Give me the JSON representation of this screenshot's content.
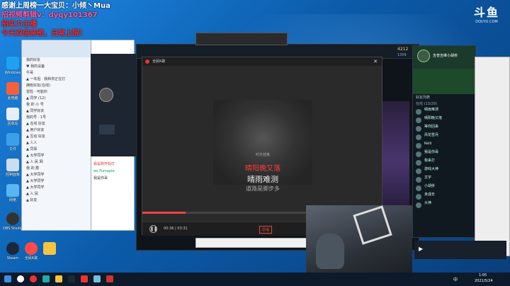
{
  "overlay": {
    "lines": [
      {
        "text": "感谢上周榜一大宝贝：小倾丶Mua",
        "color": "white"
      },
      {
        "text": "招视频剪辑v：dyqy101367",
        "color": "pink"
      },
      {
        "text": "招实力主播",
        "color": "red"
      },
      {
        "text": "今天双倍亲密，日常上限！",
        "color": "red"
      }
    ]
  },
  "logo": {
    "brand": "斗鱼",
    "url": "DOUYU.COM"
  },
  "desktop_icons": [
    {
      "label": "Windows",
      "color": "#1ea1f2"
    },
    {
      "label": "此电脑",
      "color": "#f2613c"
    },
    {
      "label": "回收站",
      "color": "#e6eef6"
    },
    {
      "label": "文件",
      "color": "#3aa0e8"
    },
    {
      "label": "控制面板",
      "color": "#cde"
    },
    {
      "label": "网络",
      "color": "#58b6f0"
    },
    {
      "label": "OBS Studio",
      "color": "#333"
    },
    {
      "label": "Steam",
      "color": "#1b2838"
    },
    {
      "label": "全民K歌",
      "color": "#ff4a4a"
    }
  ],
  "qq": {
    "rows": [
      "我的好友",
      "♥ 我的设备",
      "牛哥",
      "▲ 一年后 · 我和你正在打",
      "拥有好友(在线)",
      "冒险 · 可能你",
      "▲ 同学 (12)",
      "我 的 小 号",
      "▲ 同学好友",
      "我的号 · 1号",
      "▲ 在线  好友",
      "▲ 用户好友",
      "▲ 互动 好友",
      "▲ 人人",
      "▲ 同事",
      "▲ 大学同学",
      "▲ 人 民 网",
      "我 的 群",
      "▲ 大学同学",
      "▲ 大学同学",
      "▲ 大学同学",
      "▲ 人 民",
      "▲ 好友"
    ]
  },
  "chat": {
    "messages": [
      "我是刚开始打",
      "ws Fumaple",
      "我是你哥"
    ]
  },
  "lol": {
    "rank_text": "4212",
    "rp_text": "1309",
    "summoner": "吉普吉维小胡侨"
  },
  "music": {
    "title": "全民K歌",
    "song": "晴阳晚又落",
    "lyric_prev": "时光荏苒",
    "lyric_main": "晴雨难测",
    "lyric_next": "道路是脚步多",
    "time": "00:36 | 03:31",
    "tag": "原唱"
  },
  "friends": {
    "header": "好友列表",
    "group": "在线 (13/29)",
    "names": [
      "晴雨难测",
      "晴阳晚又落",
      "等你回来",
      "风花雪月",
      "Kelli",
      "我是你哥",
      "我来打",
      "游戏大神",
      "文字",
      "小胡侨",
      "未成年",
      "大神"
    ]
  },
  "taskbar": {
    "time": "1:05",
    "date": "2021/5/24",
    "lang": "中"
  }
}
